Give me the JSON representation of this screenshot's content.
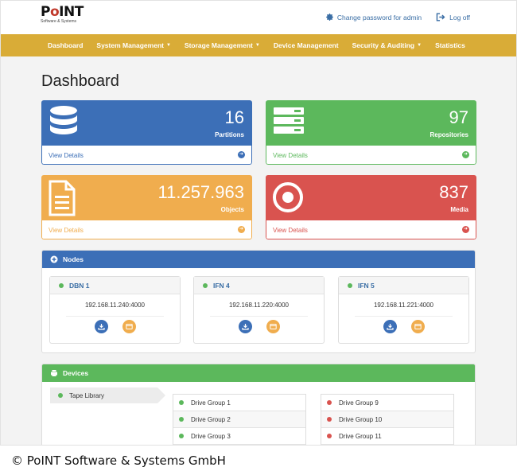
{
  "header": {
    "logo_text_a": "P",
    "logo_text_o": "o",
    "logo_text_b": "INT",
    "logo_sub": "Software & Systems",
    "change_password_label": "Change password for admin",
    "logoff_label": "Log off",
    "change_password_icon": "gear-icon",
    "logoff_icon": "sign-out-icon"
  },
  "nav": {
    "items": [
      {
        "label": "Dashboard"
      },
      {
        "label": "System Management",
        "caret": "▼"
      },
      {
        "label": "Storage Management",
        "caret": "▼"
      },
      {
        "label": "Device Management"
      },
      {
        "label": "Security & Auditing",
        "caret": "▼"
      },
      {
        "label": "Statistics"
      }
    ]
  },
  "page": {
    "title": "Dashboard"
  },
  "cards": [
    {
      "value": "16",
      "label": "Partitions",
      "link": "View Details",
      "color": "#3c6fb7",
      "icon": "database-icon"
    },
    {
      "value": "97",
      "label": "Repositories",
      "link": "View Details",
      "color": "#5cb85c",
      "icon": "server-icon"
    },
    {
      "value": "11.257.963",
      "label": "Objects",
      "link": "View Details",
      "color": "#f0ad4e",
      "icon": "document-icon"
    },
    {
      "value": "837",
      "label": "Media",
      "link": "View Details",
      "color": "#d9534f",
      "icon": "disc-icon"
    }
  ],
  "nodes_panel": {
    "title": "Nodes",
    "nodes": [
      {
        "name": "DBN 1",
        "address": "192.168.11.240:4000"
      },
      {
        "name": "IFN 4",
        "address": "192.168.11.220:4000"
      },
      {
        "name": "IFN 5",
        "address": "192.168.11.221:4000"
      }
    ]
  },
  "devices_panel": {
    "title": "Devices",
    "device": "Tape Library",
    "groups_left": [
      "Drive Group 1",
      "Drive Group 2",
      "Drive Group 3"
    ],
    "groups_right": [
      "Drive Group 9",
      "Drive Group 10",
      "Drive Group 11"
    ]
  },
  "footer": {
    "copyright": "© PoINT Software & Systems GmbH"
  }
}
